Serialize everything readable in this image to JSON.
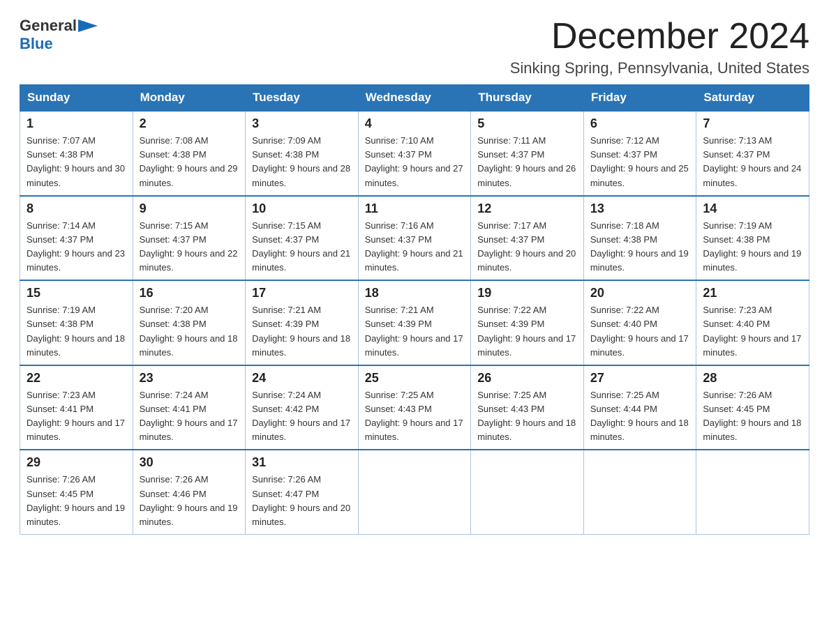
{
  "logo": {
    "general": "General",
    "blue": "Blue"
  },
  "header": {
    "month_year": "December 2024",
    "location": "Sinking Spring, Pennsylvania, United States"
  },
  "weekdays": [
    "Sunday",
    "Monday",
    "Tuesday",
    "Wednesday",
    "Thursday",
    "Friday",
    "Saturday"
  ],
  "weeks": [
    [
      {
        "day": "1",
        "sunrise": "7:07 AM",
        "sunset": "4:38 PM",
        "daylight": "9 hours and 30 minutes."
      },
      {
        "day": "2",
        "sunrise": "7:08 AM",
        "sunset": "4:38 PM",
        "daylight": "9 hours and 29 minutes."
      },
      {
        "day": "3",
        "sunrise": "7:09 AM",
        "sunset": "4:38 PM",
        "daylight": "9 hours and 28 minutes."
      },
      {
        "day": "4",
        "sunrise": "7:10 AM",
        "sunset": "4:37 PM",
        "daylight": "9 hours and 27 minutes."
      },
      {
        "day": "5",
        "sunrise": "7:11 AM",
        "sunset": "4:37 PM",
        "daylight": "9 hours and 26 minutes."
      },
      {
        "day": "6",
        "sunrise": "7:12 AM",
        "sunset": "4:37 PM",
        "daylight": "9 hours and 25 minutes."
      },
      {
        "day": "7",
        "sunrise": "7:13 AM",
        "sunset": "4:37 PM",
        "daylight": "9 hours and 24 minutes."
      }
    ],
    [
      {
        "day": "8",
        "sunrise": "7:14 AM",
        "sunset": "4:37 PM",
        "daylight": "9 hours and 23 minutes."
      },
      {
        "day": "9",
        "sunrise": "7:15 AM",
        "sunset": "4:37 PM",
        "daylight": "9 hours and 22 minutes."
      },
      {
        "day": "10",
        "sunrise": "7:15 AM",
        "sunset": "4:37 PM",
        "daylight": "9 hours and 21 minutes."
      },
      {
        "day": "11",
        "sunrise": "7:16 AM",
        "sunset": "4:37 PM",
        "daylight": "9 hours and 21 minutes."
      },
      {
        "day": "12",
        "sunrise": "7:17 AM",
        "sunset": "4:37 PM",
        "daylight": "9 hours and 20 minutes."
      },
      {
        "day": "13",
        "sunrise": "7:18 AM",
        "sunset": "4:38 PM",
        "daylight": "9 hours and 19 minutes."
      },
      {
        "day": "14",
        "sunrise": "7:19 AM",
        "sunset": "4:38 PM",
        "daylight": "9 hours and 19 minutes."
      }
    ],
    [
      {
        "day": "15",
        "sunrise": "7:19 AM",
        "sunset": "4:38 PM",
        "daylight": "9 hours and 18 minutes."
      },
      {
        "day": "16",
        "sunrise": "7:20 AM",
        "sunset": "4:38 PM",
        "daylight": "9 hours and 18 minutes."
      },
      {
        "day": "17",
        "sunrise": "7:21 AM",
        "sunset": "4:39 PM",
        "daylight": "9 hours and 18 minutes."
      },
      {
        "day": "18",
        "sunrise": "7:21 AM",
        "sunset": "4:39 PM",
        "daylight": "9 hours and 17 minutes."
      },
      {
        "day": "19",
        "sunrise": "7:22 AM",
        "sunset": "4:39 PM",
        "daylight": "9 hours and 17 minutes."
      },
      {
        "day": "20",
        "sunrise": "7:22 AM",
        "sunset": "4:40 PM",
        "daylight": "9 hours and 17 minutes."
      },
      {
        "day": "21",
        "sunrise": "7:23 AM",
        "sunset": "4:40 PM",
        "daylight": "9 hours and 17 minutes."
      }
    ],
    [
      {
        "day": "22",
        "sunrise": "7:23 AM",
        "sunset": "4:41 PM",
        "daylight": "9 hours and 17 minutes."
      },
      {
        "day": "23",
        "sunrise": "7:24 AM",
        "sunset": "4:41 PM",
        "daylight": "9 hours and 17 minutes."
      },
      {
        "day": "24",
        "sunrise": "7:24 AM",
        "sunset": "4:42 PM",
        "daylight": "9 hours and 17 minutes."
      },
      {
        "day": "25",
        "sunrise": "7:25 AM",
        "sunset": "4:43 PM",
        "daylight": "9 hours and 17 minutes."
      },
      {
        "day": "26",
        "sunrise": "7:25 AM",
        "sunset": "4:43 PM",
        "daylight": "9 hours and 18 minutes."
      },
      {
        "day": "27",
        "sunrise": "7:25 AM",
        "sunset": "4:44 PM",
        "daylight": "9 hours and 18 minutes."
      },
      {
        "day": "28",
        "sunrise": "7:26 AM",
        "sunset": "4:45 PM",
        "daylight": "9 hours and 18 minutes."
      }
    ],
    [
      {
        "day": "29",
        "sunrise": "7:26 AM",
        "sunset": "4:45 PM",
        "daylight": "9 hours and 19 minutes."
      },
      {
        "day": "30",
        "sunrise": "7:26 AM",
        "sunset": "4:46 PM",
        "daylight": "9 hours and 19 minutes."
      },
      {
        "day": "31",
        "sunrise": "7:26 AM",
        "sunset": "4:47 PM",
        "daylight": "9 hours and 20 minutes."
      },
      null,
      null,
      null,
      null
    ]
  ]
}
